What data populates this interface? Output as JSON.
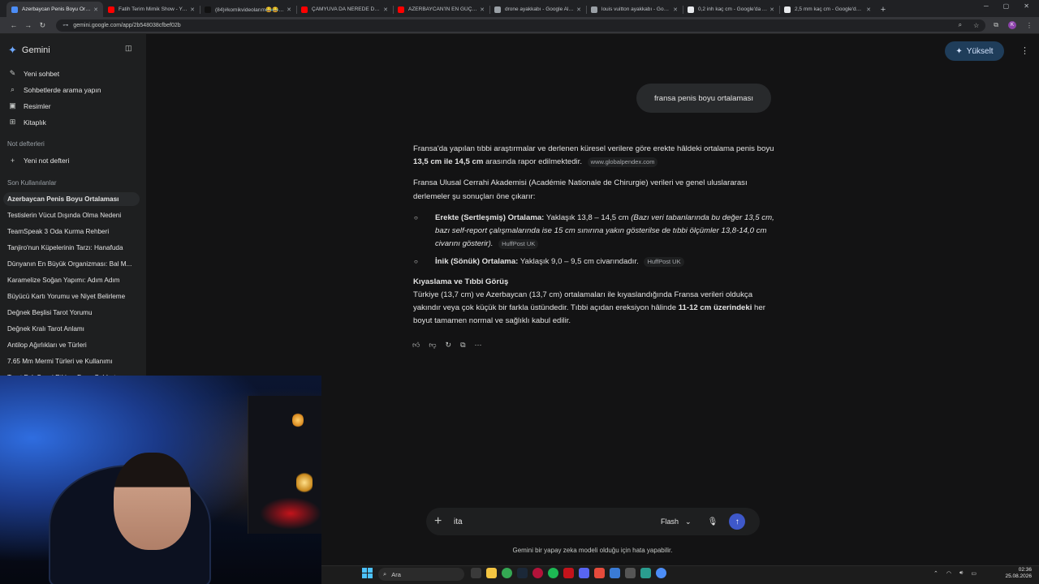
{
  "browser": {
    "tabs": [
      {
        "title": "Azerbaycan Penis Boyu Ortalam...",
        "color": "#4c8df6",
        "active": true
      },
      {
        "title": "Fatih Terim Mimik Show - YouT...",
        "color": "#ff0000"
      },
      {
        "title": "(84)#komikvideolarım😂😂😂",
        "color": "#111111"
      },
      {
        "title": "ÇAMYUVA DA NEREDE DENİZE...",
        "color": "#ff0000"
      },
      {
        "title": "AZERBAYCAN'IN EN GÜÇLÜ AS...",
        "color": "#ff0000"
      },
      {
        "title": "drone ayakkabı - Google Alışve...",
        "color": "#9aa0a6"
      },
      {
        "title": "louis vuitton ayakkabı - Google...",
        "color": "#9aa0a6"
      },
      {
        "title": "0,2 inh kaç cm - Google'da Ara",
        "color": "#e8eaed"
      },
      {
        "title": "2,5 mm kaç cm - Google'da Ara",
        "color": "#e8eaed"
      }
    ],
    "url": "gemini.google.com/app/2b548038cfbef02b",
    "profile_initial": "K"
  },
  "sidebar": {
    "brand": "Gemini",
    "nav": [
      {
        "label": "Yeni sohbet",
        "icon": "edit-icon"
      },
      {
        "label": "Sohbetlerde arama yapın",
        "icon": "search-icon"
      },
      {
        "label": "Resimler",
        "icon": "image-icon"
      },
      {
        "label": "Kitaplık",
        "icon": "library-icon"
      }
    ],
    "notes_header": "Not defterleri",
    "new_notebook": "Yeni not defteri",
    "recent_header": "Son Kullanılanlar",
    "recent": [
      "Azerbaycan Penis Boyu Ortalaması",
      "Testislerin Vücut Dışında Olma Nedeni",
      "TeamSpeak 3 Oda Kurma Rehberi",
      "Tanjiro'nun Küpelerinin Tarzı: Hanafuda",
      "Dünyanın En Büyük Organizması: Bal M...",
      "Karamelize Soğan Yapımı: Adım Adım",
      "Büyücü Kartı Yorumu ve Niyet Belirleme",
      "Değnek Beşlisi Tarot Yorumu",
      "Değnek Kralı Tarot Anlamı",
      "Antilop Ağırlıkları ve Türleri",
      "7.65 Mm Mermi Türleri ve Kullanımı",
      "Tarot Fal: Sevgi Etki ve Daşo Sohbet"
    ]
  },
  "header": {
    "upgrade_label": "Yükselt"
  },
  "conversation": {
    "user_message": "fransa penis boyu ortalaması",
    "p1_pre": "Fransa'da yapılan tıbbi araştırmalar ve derlenen küresel verilere göre erekte hâldeki ortalama penis boyu ",
    "p1_bold": "13,5 cm ile 14,5 cm",
    "p1_post": " arasında rapor edilmektedir.",
    "p1_source": "www.globalpendex.com",
    "p2": "Fransa Ulusal Cerrahi Akademisi (Académie Nationale de Chirurgie) verileri ve genel uluslararası derlemeler şu sonuçları öne çıkarır:",
    "bullet1_bold": "Erekte (Sertleşmiş) Ortalama:",
    "bullet1_text": " Yaklaşık 13,8 – 14,5 cm ",
    "bullet1_italic": "(Bazı veri tabanlarında bu değer 13,5 cm, bazı self-report çalışmalarında ise 15 cm sınırına yakın gösterilse de tıbbi ölçümler 13,8-14,0 cm civarını gösterir).",
    "bullet1_source": "HuffPost UK",
    "bullet2_bold": "İnik (Sönük) Ortalama:",
    "bullet2_text": " Yaklaşık 9,0 – 9,5 cm civarındadır.",
    "bullet2_source": "HuffPost UK",
    "heading": "Kıyaslama ve Tıbbi Görüş",
    "p3_pre": "Türkiye (13,7 cm) ve Azerbaycan (13,7 cm) ortalamaları ile kıyaslandığında Fransa verileri oldukça yakındır veya çok küçük bir farkla üstündedir. Tıbbi açıdan ereksiyon hâlinde ",
    "p3_bold": "11-12 cm üzerindeki",
    "p3_post": " her boyut tamamen normal ve sağlıklı kabul edilir."
  },
  "composer": {
    "value": "ita",
    "model": "Flash"
  },
  "disclaimer": "Gemini bir yapay zeka modeli olduğu için hata yapabilir.",
  "taskbar": {
    "search_label": "Ara",
    "time": "02:36",
    "date": "25.08.2026"
  }
}
